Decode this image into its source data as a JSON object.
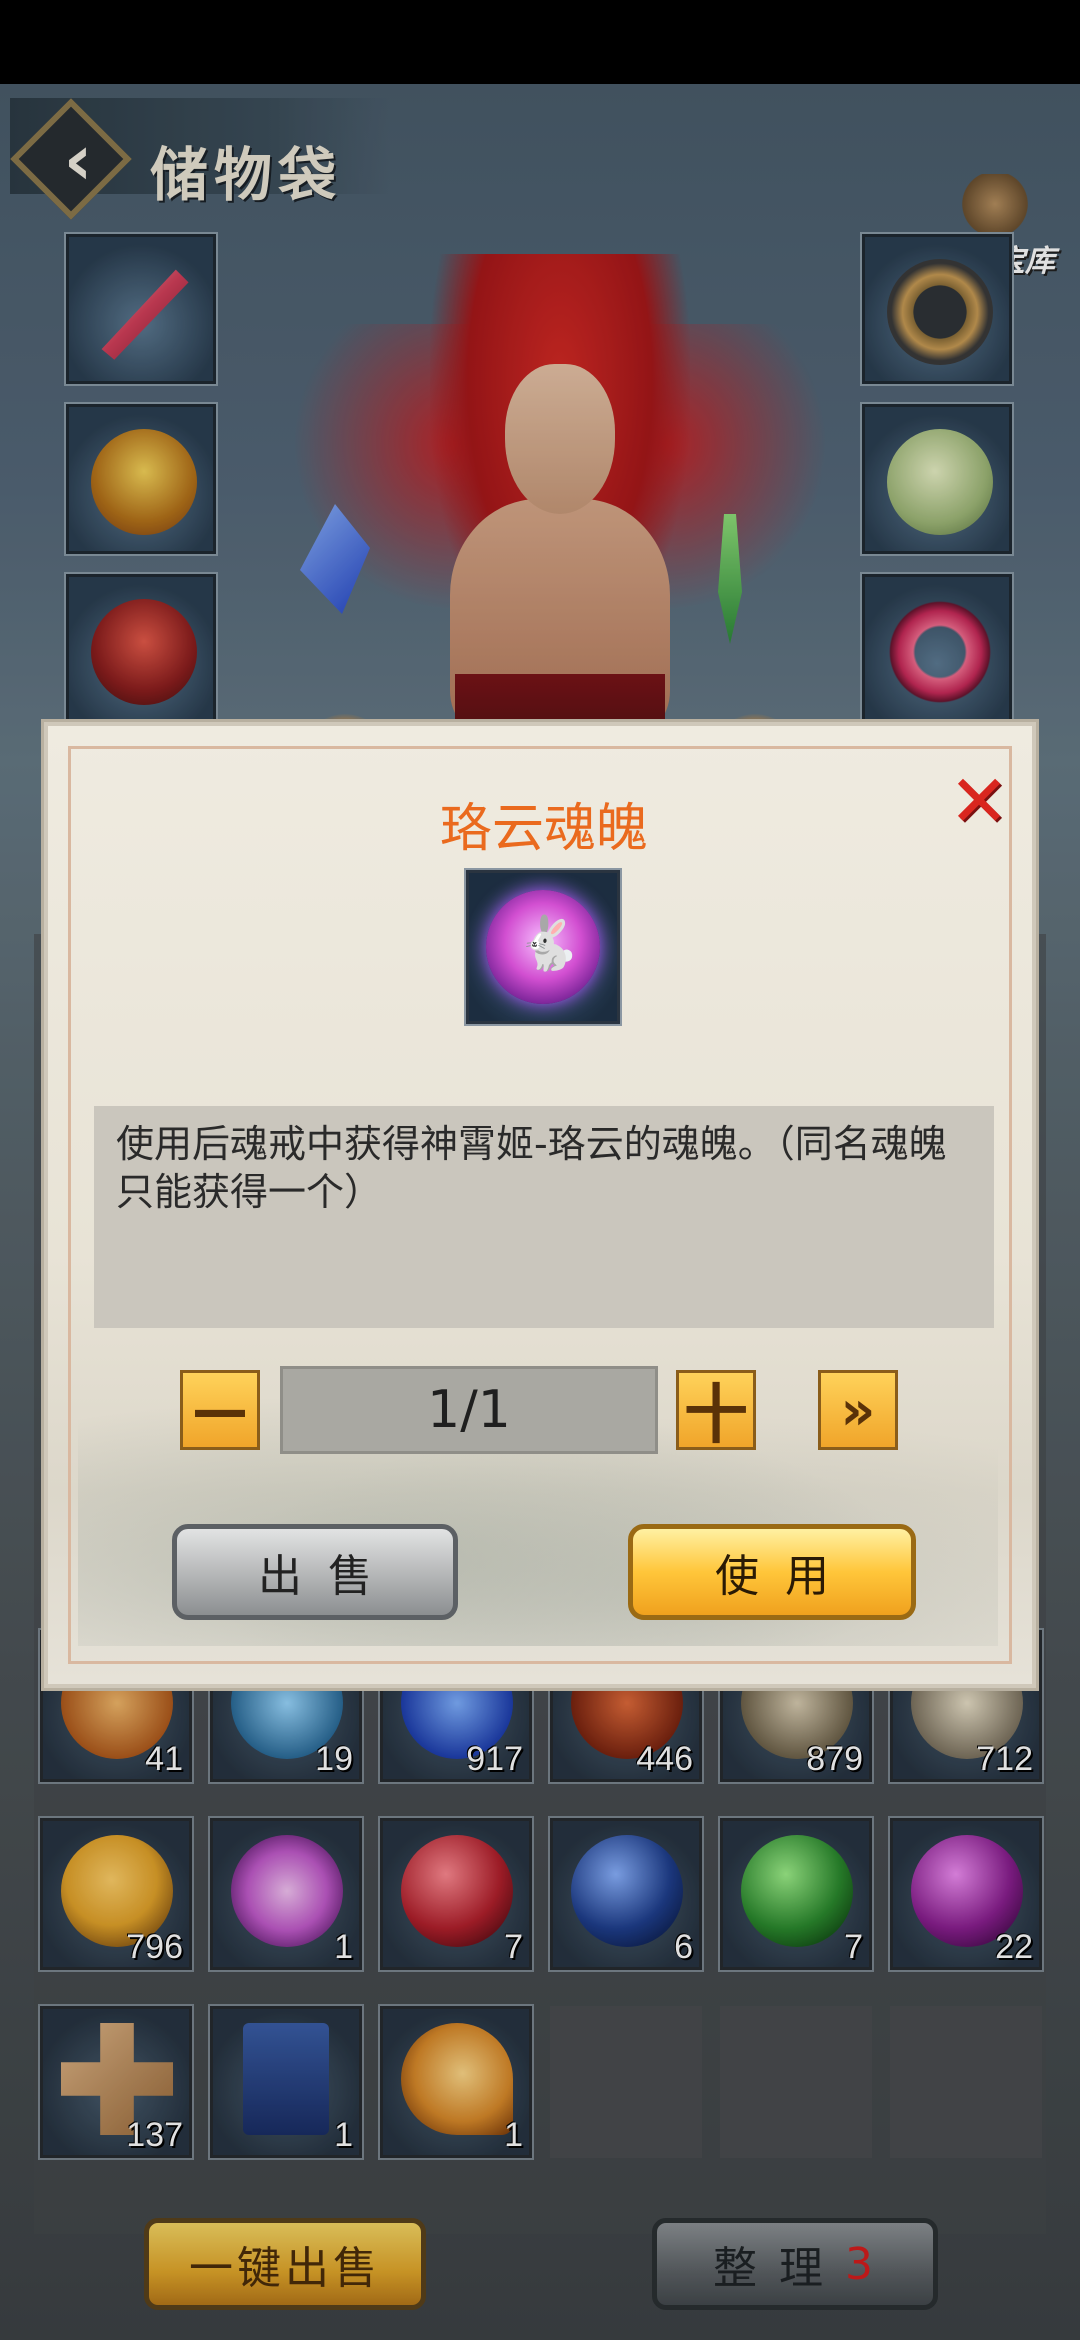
{
  "header": {
    "title": "储物袋",
    "treasury_label": "龙王宝库"
  },
  "equipment": {
    "left": [
      {
        "icon": "sword-icon"
      },
      {
        "icon": "helmet-icon"
      },
      {
        "icon": "armor-icon"
      }
    ],
    "right": [
      {
        "icon": "dark-ring-icon"
      },
      {
        "icon": "jade-pendant-icon"
      },
      {
        "icon": "pink-ring-icon"
      }
    ]
  },
  "inventory": {
    "row1": [
      {
        "icon": "orange-orb-icon",
        "count": "41"
      },
      {
        "icon": "blue-swirl-icon",
        "count": "19"
      },
      {
        "icon": "blue-crystal-icon",
        "count": "917"
      },
      {
        "icon": "red-cage-icon",
        "count": "446"
      },
      {
        "icon": "claw-icon",
        "count": "879"
      },
      {
        "icon": "fang-icon",
        "count": "712"
      }
    ],
    "row2": [
      {
        "icon": "golden-orb-icon",
        "count": "796",
        "color": "#e2a32a"
      },
      {
        "icon": "rabbit-soul-icon",
        "count": "1",
        "color": "#c25bcc"
      },
      {
        "icon": "red-pearl-icon",
        "count": "7",
        "color": "#b2202c"
      },
      {
        "icon": "blue-pearl-icon",
        "count": "6",
        "color": "#1f3f8e"
      },
      {
        "icon": "green-pearl-icon",
        "count": "7",
        "color": "#2b8a2e"
      },
      {
        "icon": "purple-pearl-icon",
        "count": "22",
        "color": "#8a1f90"
      }
    ],
    "row3": [
      {
        "icon": "wooden-knot-icon",
        "count": "137"
      },
      {
        "icon": "book-icon",
        "count": "1"
      },
      {
        "icon": "amulet-icon",
        "count": "1"
      }
    ]
  },
  "bottom": {
    "sell_all_label": "一键出售",
    "sort_label": "整 理",
    "sort_count": "3"
  },
  "dialog": {
    "title": "珞云魂魄",
    "item_icon": "rabbit-soul-icon",
    "description": "使用后魂戒中获得神霄姬-珞云的魂魄。（同名魂魄只能获得一个）",
    "minus_label": "—",
    "plus_label": "十",
    "max_label": "»",
    "quantity": "1/1",
    "sell_label": "出售",
    "use_label": "使用",
    "close_label": "✕"
  },
  "colors": {
    "title_orange": "#ea6a1e",
    "close_red": "#d9261f",
    "sort_count_red": "#d61d1d"
  }
}
